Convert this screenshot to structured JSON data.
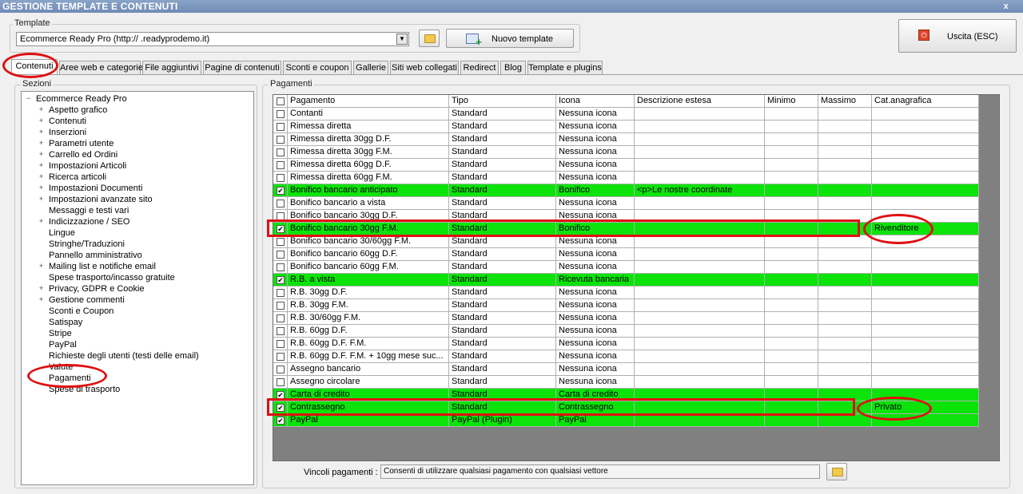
{
  "window": {
    "title": "GESTIONE TEMPLATE E CONTENUTI",
    "close_glyph": "x"
  },
  "template": {
    "group_label": "Template",
    "selected": "Ecommerce Ready Pro (http://        .readyprodemo.it)",
    "new_button": "Nuovo template"
  },
  "exit_button": "Uscita (ESC)",
  "tabs": [
    "Contenuti",
    "Aree web e categorie",
    "File aggiuntivi",
    "Pagine di contenuti",
    "Sconti e coupon",
    "Gallerie",
    "Siti web collegati",
    "Redirect",
    "Blog",
    "Template e plugins"
  ],
  "sections": {
    "label": "Sezioni",
    "root": "Ecommerce Ready Pro",
    "items": [
      {
        "label": "Aspetto grafico",
        "expandable": true
      },
      {
        "label": "Contenuti",
        "expandable": true
      },
      {
        "label": "Inserzioni",
        "expandable": true
      },
      {
        "label": "Parametri utente",
        "expandable": true
      },
      {
        "label": "Carrello ed Ordini",
        "expandable": true
      },
      {
        "label": "Impostazioni Articoli",
        "expandable": true
      },
      {
        "label": "Ricerca articoli",
        "expandable": true
      },
      {
        "label": "Impostazioni Documenti",
        "expandable": true
      },
      {
        "label": "Impostazioni avanzate sito",
        "expandable": true
      },
      {
        "label": "Messaggi e testi vari",
        "expandable": false
      },
      {
        "label": "Indicizzazione / SEO",
        "expandable": true
      },
      {
        "label": "Lingue",
        "expandable": false
      },
      {
        "label": "Stringhe/Traduzioni",
        "expandable": false
      },
      {
        "label": "Pannello amministrativo",
        "expandable": false
      },
      {
        "label": "Mailing list e notifiche email",
        "expandable": true
      },
      {
        "label": "Spese trasporto/incasso gratuite",
        "expandable": false
      },
      {
        "label": "Privacy, GDPR e Cookie",
        "expandable": true
      },
      {
        "label": "Gestione commenti",
        "expandable": true
      },
      {
        "label": "Sconti e Coupon",
        "expandable": false
      },
      {
        "label": "Satispay",
        "expandable": false
      },
      {
        "label": "Stripe",
        "expandable": false
      },
      {
        "label": "PayPal",
        "expandable": false
      },
      {
        "label": "Richieste degli utenti (testi delle email)",
        "expandable": false
      },
      {
        "label": "Valute",
        "expandable": false
      },
      {
        "label": "Pagamenti",
        "expandable": false
      },
      {
        "label": "Spese di trasporto",
        "expandable": false
      }
    ]
  },
  "payments": {
    "label": "Pagamenti",
    "columns": [
      "Pagamento",
      "Tipo",
      "Icona",
      "Descrizione estesa",
      "Minimo",
      "Massimo",
      "Cat.anagrafica"
    ],
    "rows": [
      {
        "checked": false,
        "cells": [
          "Contanti",
          "Standard",
          "Nessuna icona",
          "",
          "",
          "",
          ""
        ]
      },
      {
        "checked": false,
        "cells": [
          "Rimessa diretta",
          "Standard",
          "Nessuna icona",
          "",
          "",
          "",
          ""
        ]
      },
      {
        "checked": false,
        "cells": [
          "Rimessa diretta 30gg D.F.",
          "Standard",
          "Nessuna icona",
          "",
          "",
          "",
          ""
        ]
      },
      {
        "checked": false,
        "cells": [
          "Rimessa diretta 30gg F.M.",
          "Standard",
          "Nessuna icona",
          "",
          "",
          "",
          ""
        ]
      },
      {
        "checked": false,
        "cells": [
          "Rimessa diretta 60gg D.F.",
          "Standard",
          "Nessuna icona",
          "",
          "",
          "",
          ""
        ]
      },
      {
        "checked": false,
        "cells": [
          "Rimessa diretta 60gg F.M.",
          "Standard",
          "Nessuna icona",
          "",
          "",
          "",
          ""
        ]
      },
      {
        "checked": true,
        "cells": [
          "Bonifico bancario anticipato",
          "Standard",
          "Bonifico",
          "<p>Le nostre coordinate",
          "",
          "",
          ""
        ]
      },
      {
        "checked": false,
        "cells": [
          "Bonifico bancario a vista",
          "Standard",
          "Nessuna icona",
          "",
          "",
          "",
          ""
        ]
      },
      {
        "checked": false,
        "cells": [
          "Bonifico bancario 30gg D.F.",
          "Standard",
          "Nessuna icona",
          "",
          "",
          "",
          ""
        ]
      },
      {
        "checked": true,
        "cells": [
          "Bonifico bancario 30gg F.M.",
          "Standard",
          "Bonifico",
          "",
          "",
          "",
          "Rivenditore"
        ]
      },
      {
        "checked": false,
        "cells": [
          "Bonifico bancario 30/60gg F.M.",
          "Standard",
          "Nessuna icona",
          "",
          "",
          "",
          ""
        ]
      },
      {
        "checked": false,
        "cells": [
          "Bonifico bancario 60gg D.F.",
          "Standard",
          "Nessuna icona",
          "",
          "",
          "",
          ""
        ]
      },
      {
        "checked": false,
        "cells": [
          "Bonifico bancario 60gg F.M.",
          "Standard",
          "Nessuna icona",
          "",
          "",
          "",
          ""
        ]
      },
      {
        "checked": true,
        "cells": [
          "R.B. a vista",
          "Standard",
          "Ricevuta bancaria",
          "",
          "",
          "",
          ""
        ]
      },
      {
        "checked": false,
        "cells": [
          "R.B. 30gg D.F.",
          "Standard",
          "Nessuna icona",
          "",
          "",
          "",
          ""
        ]
      },
      {
        "checked": false,
        "cells": [
          "R.B. 30gg F.M.",
          "Standard",
          "Nessuna icona",
          "",
          "",
          "",
          ""
        ]
      },
      {
        "checked": false,
        "cells": [
          "R.B. 30/60gg F.M.",
          "Standard",
          "Nessuna icona",
          "",
          "",
          "",
          ""
        ]
      },
      {
        "checked": false,
        "cells": [
          "R.B. 60gg D.F.",
          "Standard",
          "Nessuna icona",
          "",
          "",
          "",
          ""
        ]
      },
      {
        "checked": false,
        "cells": [
          "R.B. 60gg D.F. F.M.",
          "Standard",
          "Nessuna icona",
          "",
          "",
          "",
          ""
        ]
      },
      {
        "checked": false,
        "cells": [
          "R.B. 60gg D.F. F.M. + 10gg mese suc...",
          "Standard",
          "Nessuna icona",
          "",
          "",
          "",
          ""
        ]
      },
      {
        "checked": false,
        "cells": [
          "Assegno bancario",
          "Standard",
          "Nessuna icona",
          "",
          "",
          "",
          ""
        ]
      },
      {
        "checked": false,
        "cells": [
          "Assegno circolare",
          "Standard",
          "Nessuna icona",
          "",
          "",
          "",
          ""
        ]
      },
      {
        "checked": true,
        "cells": [
          "Carta di credito",
          "Standard",
          "Carta di credito",
          "",
          "",
          "",
          ""
        ]
      },
      {
        "checked": true,
        "cells": [
          "Contrassegno",
          "Standard",
          "Contrassegno",
          "",
          "",
          "",
          "Privato"
        ]
      },
      {
        "checked": true,
        "cells": [
          "PayPal",
          "PayPal (Plugin)",
          "PayPal",
          "",
          "",
          "",
          ""
        ]
      }
    ]
  },
  "vincoli": {
    "label": "Vincoli pagamenti :",
    "value": "Consenti di utilizzare qualsiasi pagamento con qualsiasi vettore"
  },
  "colors": {
    "highlight_row": "#0be30b",
    "annotation": "#e01010",
    "title_bar": "#7a96c0"
  }
}
